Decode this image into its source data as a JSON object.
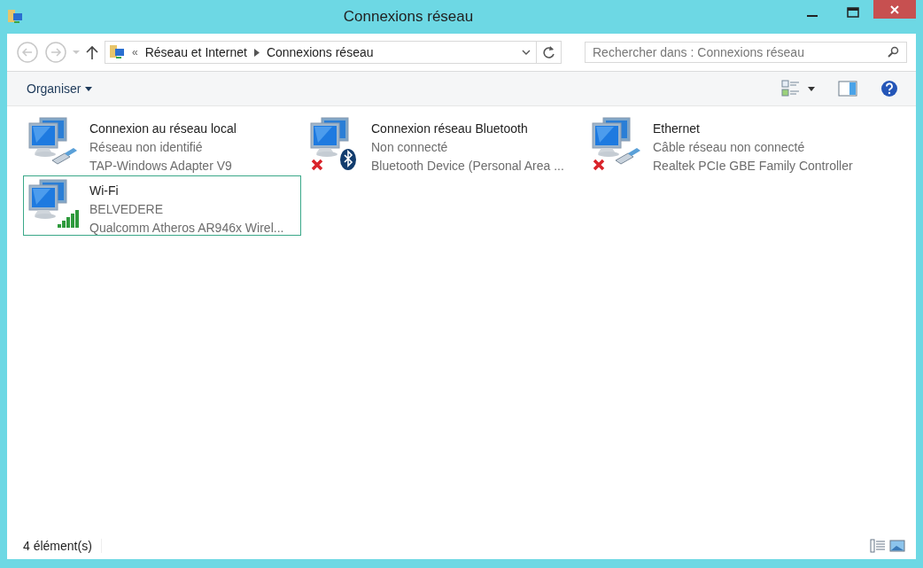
{
  "window": {
    "title": "Connexions réseau"
  },
  "navigation": {
    "breadcrumb_overflow": "«",
    "breadcrumb": [
      "Réseau et Internet",
      "Connexions réseau"
    ],
    "search": {
      "placeholder": "Rechercher dans : Connexions réseau"
    }
  },
  "toolbar": {
    "organize": "Organiser"
  },
  "connections": [
    {
      "kind": "wired",
      "name": "Connexion au réseau local",
      "status": "Réseau non identifié",
      "device": "TAP-Windows Adapter V9",
      "disconnected": false,
      "selected": false
    },
    {
      "kind": "bluetooth",
      "name": "Connexion réseau Bluetooth",
      "status": "Non connecté",
      "device": "Bluetooth Device (Personal Area ...",
      "disconnected": true,
      "selected": false
    },
    {
      "kind": "wired",
      "name": "Ethernet",
      "status": "Câble réseau non connecté",
      "device": "Realtek PCIe GBE Family Controller",
      "disconnected": true,
      "selected": false
    },
    {
      "kind": "wifi",
      "name": "Wi-Fi",
      "status": "BELVEDERE",
      "device": "Qualcomm Atheros AR946x Wirel...",
      "disconnected": false,
      "selected": true
    }
  ],
  "status_bar": {
    "count": "4 élément(s)"
  }
}
